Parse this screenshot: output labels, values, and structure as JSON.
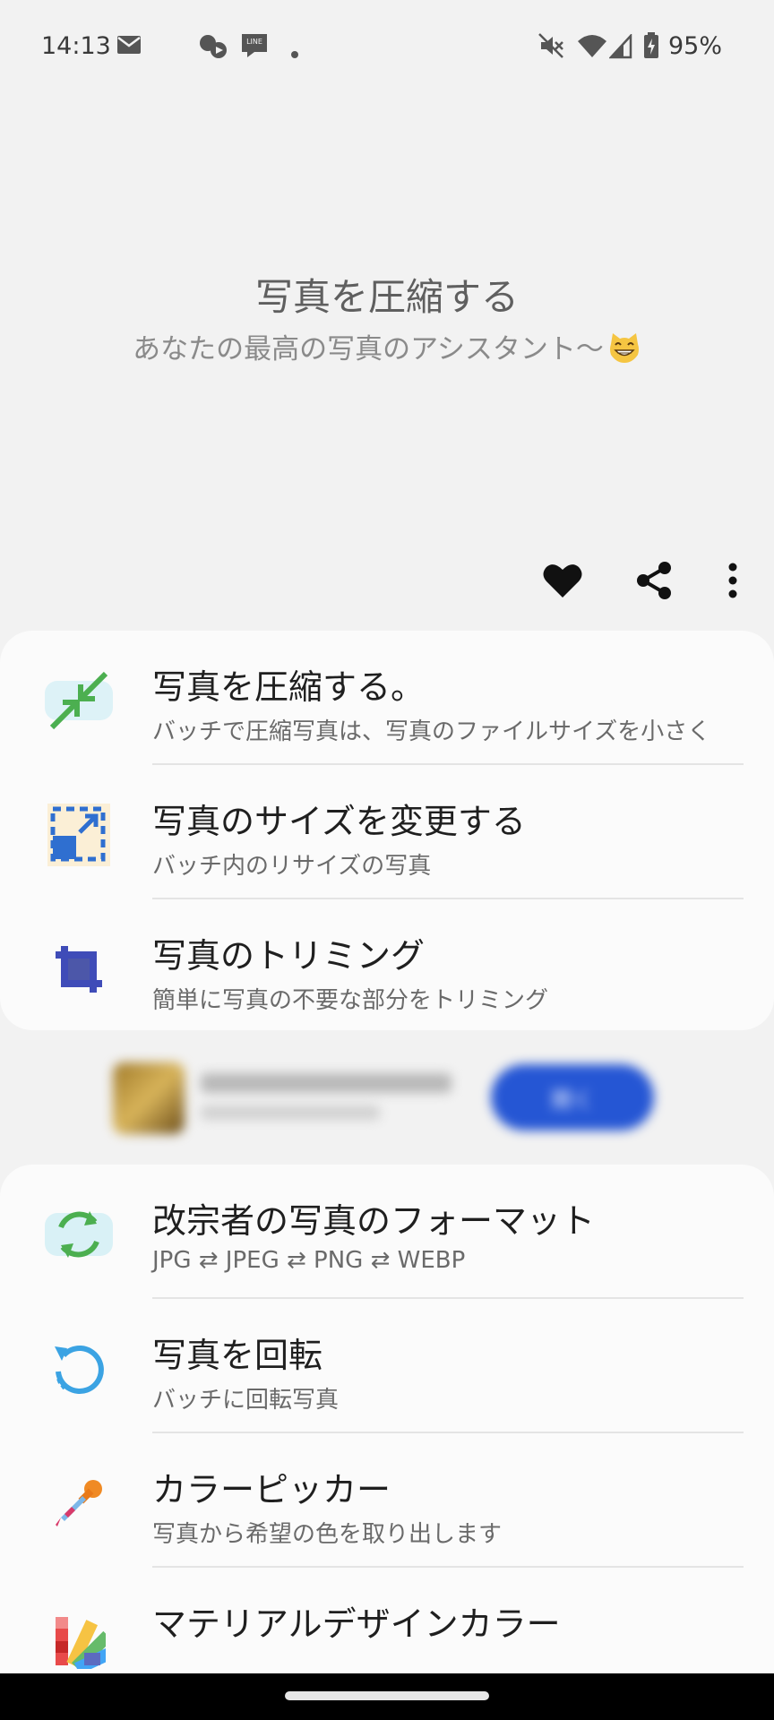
{
  "status_bar": {
    "time": "14:13",
    "battery": "95%",
    "icons": [
      "mail-icon",
      "weather-icon",
      "line-manga-icon",
      "dot-icon",
      "mute-icon",
      "wifi-icon",
      "signal-icon",
      "battery-icon"
    ]
  },
  "header": {
    "title": "写真を圧縮する",
    "subtitle": "あなたの最高の写真のアシスタント〜"
  },
  "actions": [
    "favorite-heart-icon",
    "share-icon",
    "more-vert-icon"
  ],
  "menu_top": [
    {
      "title": "写真を圧縮する。",
      "subtitle": "バッチで圧縮写真は、写真のファイルサイズを小さく",
      "icon": "compress-icon"
    },
    {
      "title": "写真のサイズを変更する",
      "subtitle": "バッチ内のリサイズの写真",
      "icon": "resize-icon"
    },
    {
      "title": "写真のトリミング",
      "subtitle": "簡単に写真の不要な部分をトリミング",
      "icon": "crop-icon"
    }
  ],
  "menu_bottom": [
    {
      "title": "改宗者の写真のフォーマット",
      "subtitle": "JPG ⇄ JPEG ⇄ PNG ⇄ WEBP",
      "icon": "convert-format-icon"
    },
    {
      "title": "写真を回転",
      "subtitle": "バッチに回転写真",
      "icon": "rotate-icon"
    },
    {
      "title": "カラーピッカー",
      "subtitle": "写真から希望の色を取り出します",
      "icon": "color-picker-icon"
    },
    {
      "title": "マテリアルデザインカラー",
      "subtitle": "",
      "icon": "material-palette-icon"
    }
  ],
  "ad": {
    "button_label": "開く"
  },
  "colors": {
    "background": "#f2f2f2",
    "card": "#fbfbfb",
    "accent_blue": "#2f5bd0",
    "compress_green": "#4caf50"
  }
}
